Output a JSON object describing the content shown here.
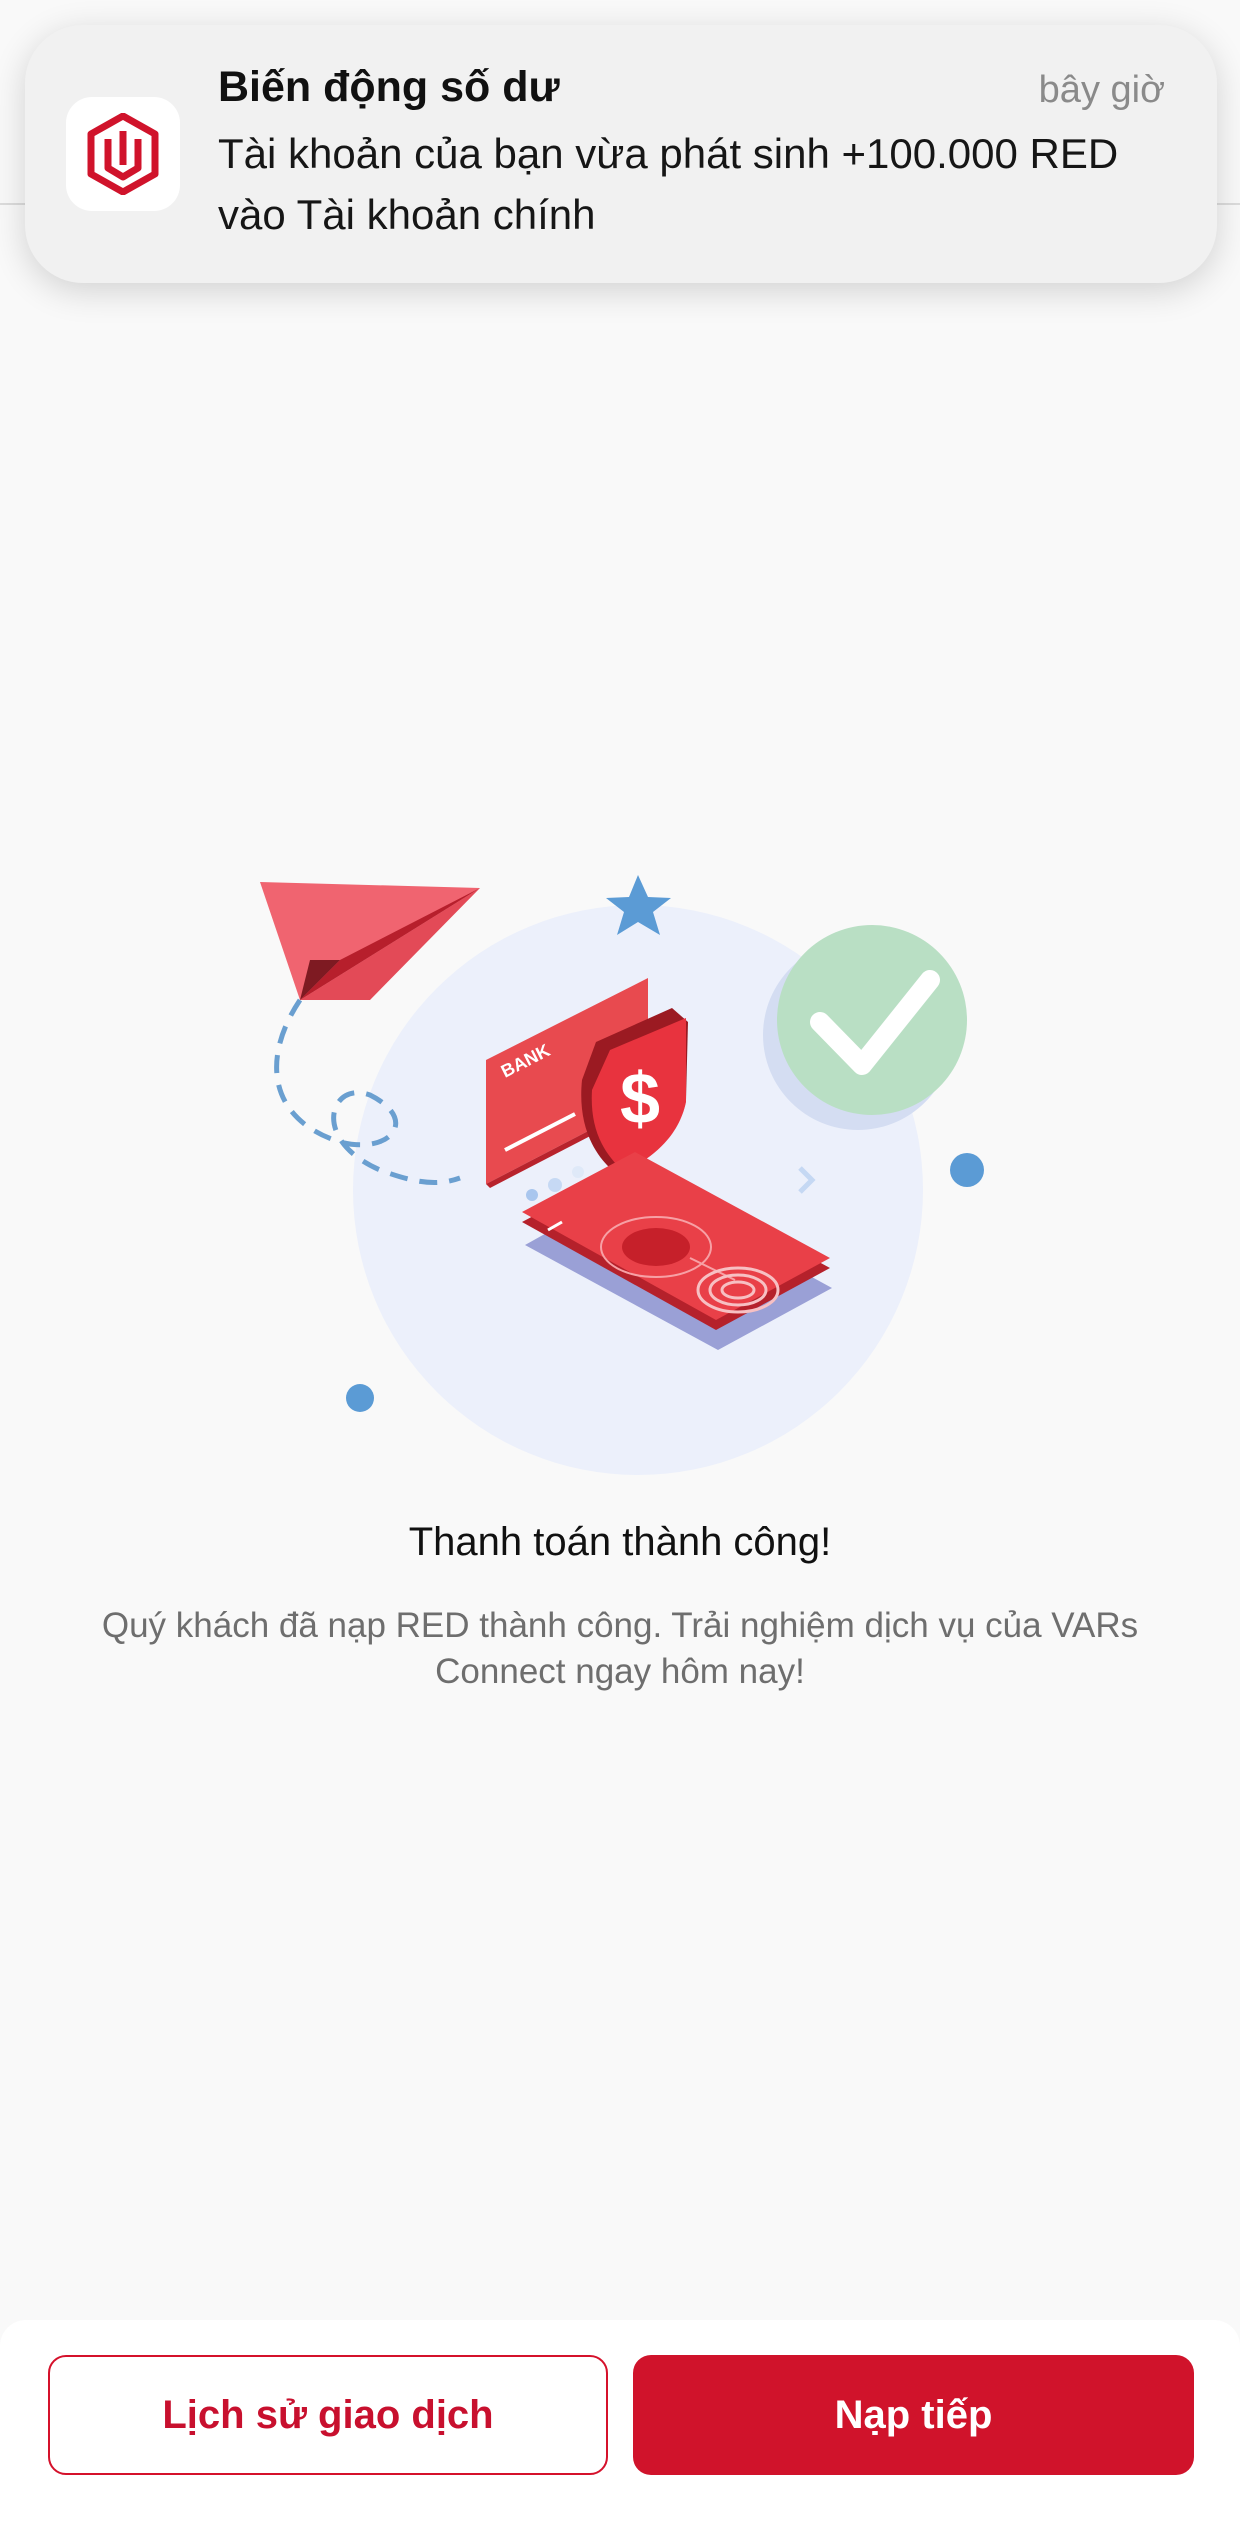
{
  "notification": {
    "app_icon": "app-logo-icon",
    "title": "Biến động số dư",
    "time": "bây giờ",
    "message": "Tài khoản của bạn vừa phát sinh +100.000 RED vào Tài khoản chính"
  },
  "illustration": {
    "card_label": "BANK",
    "icon_names": [
      "paper-plane-icon",
      "star-icon",
      "check-icon",
      "shield-dollar-icon",
      "bank-card-icon",
      "phone-fingerprint-icon"
    ]
  },
  "result": {
    "title": "Thanh toán thành công!",
    "description": "Quý khách đã nạp RED thành công. Trải nghiệm dịch vụ của VARs Connect ngay hôm nay!"
  },
  "actions": {
    "history_label": "Lịch sử giao dịch",
    "topup_label": "Nạp tiếp"
  },
  "colors": {
    "brand_red": "#d0132b",
    "success_green": "#b9dfc4",
    "illustration_bg": "#ecf0fb",
    "accent_blue": "#5b9bd5"
  }
}
